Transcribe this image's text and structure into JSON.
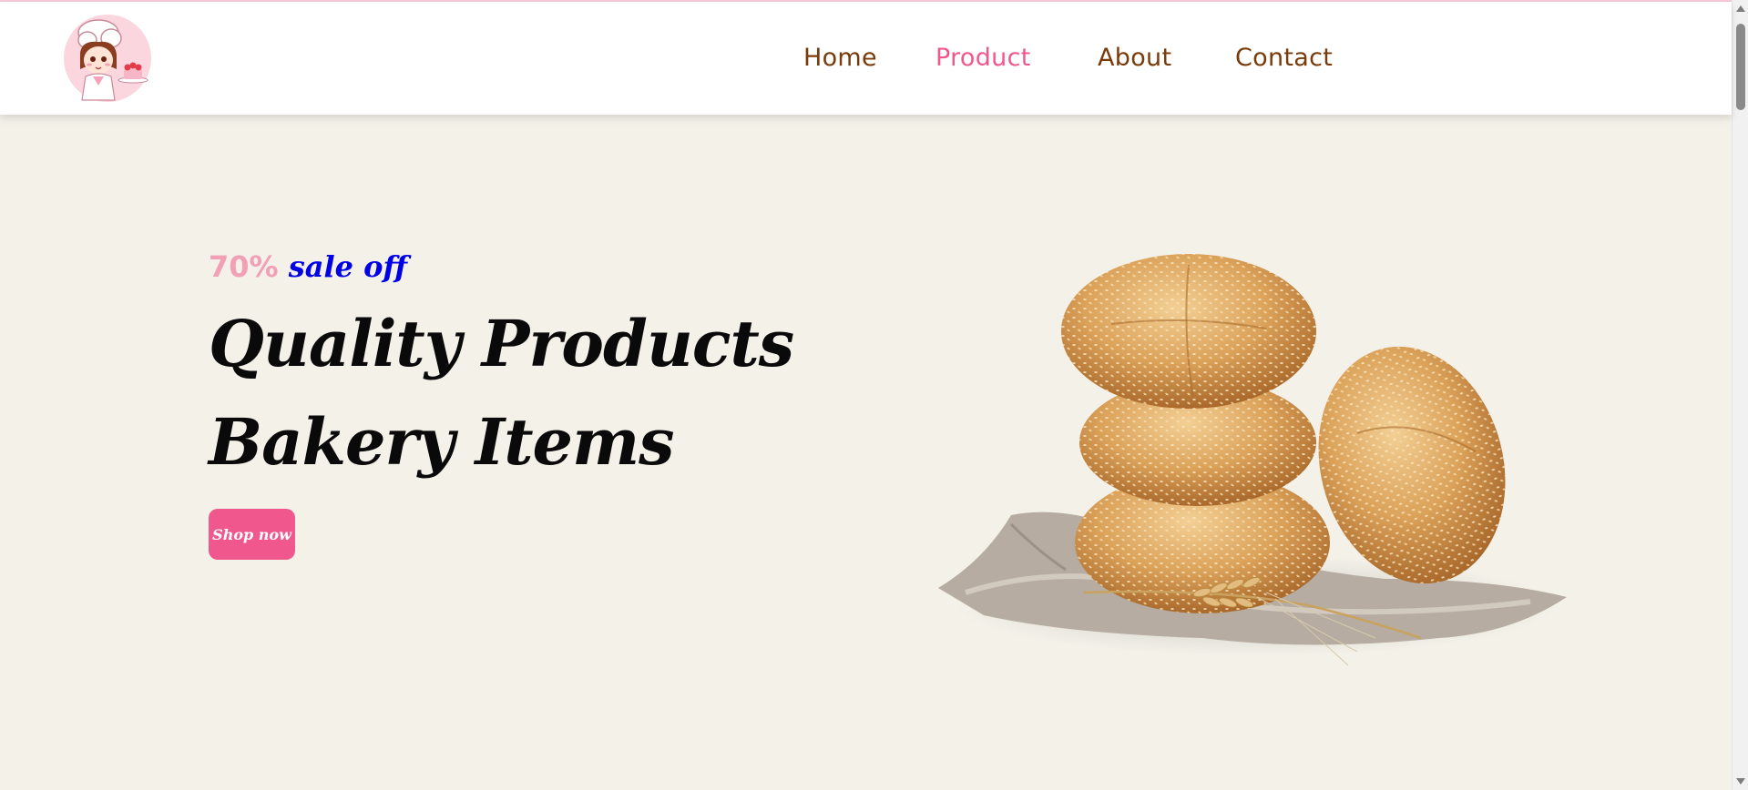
{
  "nav": {
    "links": [
      {
        "label": "Home",
        "active": false
      },
      {
        "label": "Product",
        "active": true
      },
      {
        "label": "About",
        "active": false
      },
      {
        "label": "Contact",
        "active": false
      }
    ]
  },
  "hero": {
    "sale_percent": "70%",
    "sale_text": "sale off",
    "headline_line1": "Quality Products",
    "headline_line2": "Bakery Items",
    "button_label": "Shop now"
  },
  "colors": {
    "accent": "#f0588d",
    "nav_text": "#7a3b0a",
    "sale_percent": "#f2a0b4",
    "sale_text": "#0000e6",
    "hero_bg": "#f4f1e9"
  },
  "icons": {
    "logo": "chef-girl-logo",
    "hero_image": "sesame-bread-rolls-image"
  }
}
